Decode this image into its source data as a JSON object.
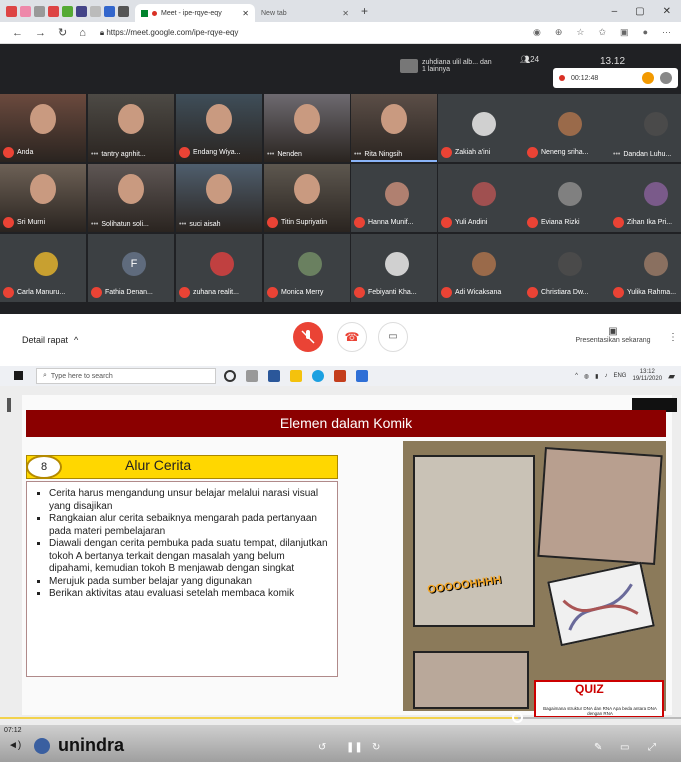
{
  "browser": {
    "active_tab": "Meet - ipe-rqye-eqy",
    "inactive_tab": "New tab",
    "new_tab_symbol": "+",
    "url": "https://meet.google.com/ipe-rqye-eqy",
    "win_min": "–",
    "win_max": "▢",
    "win_close": "✕"
  },
  "meet": {
    "presenter_info": "zuhdiana ulil alb... dan 1 lainnya",
    "participant_count": "24",
    "clock": "13.12",
    "rec_time": "00:12:48",
    "tiles": [
      {
        "name": "Anda",
        "muted": true
      },
      {
        "name": "tantry agnhit...",
        "muted": false
      },
      {
        "name": "Endang Wiya...",
        "muted": true
      },
      {
        "name": "Nenden",
        "muted": false
      },
      {
        "name": "Rita Ningsih",
        "muted": false
      },
      {
        "name": "Zakiah a'ini",
        "muted": true
      },
      {
        "name": "Neneng sriha...",
        "muted": true
      },
      {
        "name": "Dandan Luhu...",
        "muted": false
      },
      {
        "name": "Sri Murni",
        "muted": true
      },
      {
        "name": "Solihatun soli...",
        "muted": false
      },
      {
        "name": "suci aisah",
        "muted": false
      },
      {
        "name": "Titin Supriyatin",
        "muted": true
      },
      {
        "name": "Hanna Munif...",
        "muted": true
      },
      {
        "name": "Yuli Andini",
        "muted": true
      },
      {
        "name": "Eviana Rizki",
        "muted": true
      },
      {
        "name": "Zihan Ika Pri...",
        "muted": true
      },
      {
        "name": "Carla Manuru...",
        "muted": true
      },
      {
        "name": "Fathia Denan...",
        "muted": true
      },
      {
        "name": "zuhana realit...",
        "muted": true
      },
      {
        "name": "Monica Merry",
        "muted": true
      },
      {
        "name": "Febiyanti Kha...",
        "muted": true
      },
      {
        "name": "Adi Wicaksana",
        "muted": true
      },
      {
        "name": "Christiara Dw...",
        "muted": true
      },
      {
        "name": "Yulika Rahma...",
        "muted": true
      }
    ],
    "fathia_initial": "F",
    "detail_label": "Detail rapat",
    "present_label": "Presentasikan sekarang"
  },
  "taskbar": {
    "search_placeholder": "Type here to search",
    "lang": "ENG",
    "time": "13:12",
    "date": "19/11/2020"
  },
  "slide": {
    "title": "Elemen dalam Komik",
    "number": "8",
    "heading": "Alur Cerita",
    "bullets": [
      "Cerita harus mengandung unsur belajar melalui narasi visual yang disajikan",
      "Rangkaian alur cerita sebaiknya mengarah pada pertanyaan pada materi pembelajaran",
      "Diawali dengan cerita pembuka pada suatu tempat, dilanjutkan tokoh A bertanya terkait dengan masalah yang belum dipahami, kemudian tokoh B menjawab dengan singkat",
      "Merujuk pada sumber belajar yang digunakan",
      "Berikan aktivitas atau evaluasi setelah membaca komik"
    ],
    "comic_sfx": "OOOOOHHHH",
    "quiz_label": "QUIZ",
    "quiz_question": "Bagaimana struktur DNA dan RNA Apa beda antara DNA dengan RNA"
  },
  "video": {
    "elapsed": "07:12",
    "progress": 0.76,
    "logo": "unindra"
  },
  "colors": {
    "meet_bg": "#202124",
    "mute_red": "#ea4335",
    "slide_title": "#8b0000",
    "heading_yellow": "#ffd700"
  }
}
